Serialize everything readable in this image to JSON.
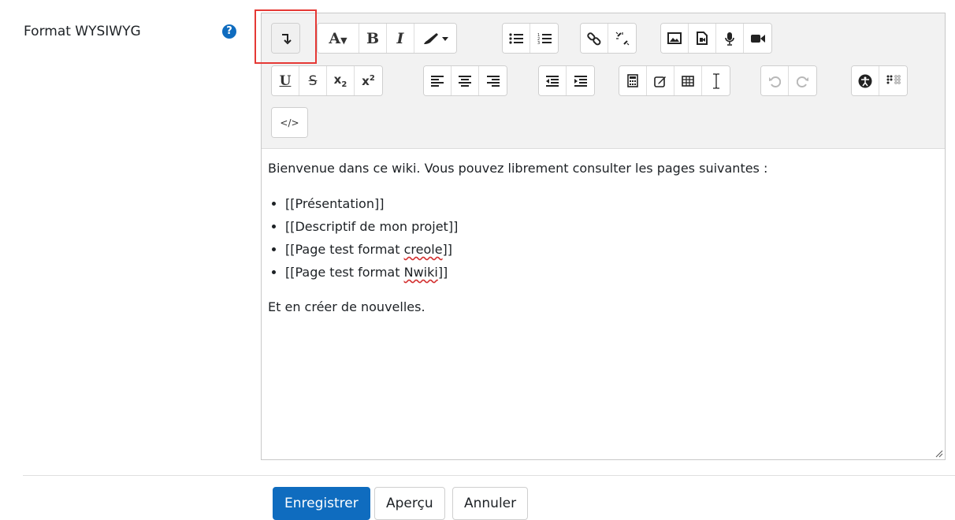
{
  "field": {
    "label": "Format WYSIWYG",
    "help_icon": "question-circle-icon",
    "help_glyph": "?"
  },
  "toolbar": {
    "rows": [
      [
        {
          "group": "collapse",
          "buttons": [
            {
              "name": "toolbar-toggle-button",
              "icon": "arrow-down-bar-icon",
              "glyph": "↧"
            }
          ]
        },
        {
          "group": "style",
          "buttons": [
            {
              "name": "paragraph-styles-button",
              "icon": "font-a-dropdown-icon",
              "glyph": "A▾"
            },
            {
              "name": "bold-button",
              "icon": "bold-icon",
              "glyph": "B"
            },
            {
              "name": "italic-button",
              "icon": "italic-icon",
              "glyph": "I"
            },
            {
              "name": "text-color-button",
              "icon": "brush-dropdown-icon",
              "glyph": "🖌▾"
            }
          ]
        },
        {
          "group": "list",
          "buttons": [
            {
              "name": "unordered-list-button",
              "icon": "bullet-list-icon",
              "glyph": "☰"
            },
            {
              "name": "ordered-list-button",
              "icon": "numbered-list-icon",
              "glyph": "⒈"
            }
          ]
        },
        {
          "group": "links",
          "buttons": [
            {
              "name": "link-button",
              "icon": "link-icon",
              "glyph": "🔗"
            },
            {
              "name": "unlink-button",
              "icon": "unlink-icon",
              "glyph": "⛓"
            }
          ]
        },
        {
          "group": "files",
          "buttons": [
            {
              "name": "image-button",
              "icon": "image-icon",
              "glyph": "▣"
            },
            {
              "name": "media-button",
              "icon": "file-media-icon",
              "glyph": "▤"
            },
            {
              "name": "record-audio-button",
              "icon": "microphone-icon",
              "glyph": "🎙"
            },
            {
              "name": "record-video-button",
              "icon": "video-camera-icon",
              "glyph": "■◀"
            }
          ]
        }
      ],
      [
        {
          "group": "style2",
          "buttons": [
            {
              "name": "underline-button",
              "icon": "underline-icon",
              "glyph": "U"
            },
            {
              "name": "strikethrough-button",
              "icon": "strikethrough-icon",
              "glyph": "S"
            },
            {
              "name": "subscript-button",
              "icon": "subscript-icon",
              "glyph": "x₂"
            },
            {
              "name": "superscript-button",
              "icon": "superscript-icon",
              "glyph": "x²"
            }
          ]
        },
        {
          "group": "align",
          "buttons": [
            {
              "name": "align-left-button",
              "icon": "align-left-icon",
              "glyph": "≡"
            },
            {
              "name": "align-center-button",
              "icon": "align-center-icon",
              "glyph": "≡"
            },
            {
              "name": "align-right-button",
              "icon": "align-right-icon",
              "glyph": "≡"
            }
          ]
        },
        {
          "group": "indent",
          "buttons": [
            {
              "name": "outdent-button",
              "icon": "outdent-icon",
              "glyph": "⇤"
            },
            {
              "name": "indent-button",
              "icon": "indent-icon",
              "glyph": "⇥"
            }
          ]
        },
        {
          "group": "insert",
          "buttons": [
            {
              "name": "equation-button",
              "icon": "calculator-icon",
              "glyph": "▦"
            },
            {
              "name": "special-chars-button",
              "icon": "edit-pencil-icon",
              "glyph": "✎"
            },
            {
              "name": "table-button",
              "icon": "table-icon",
              "glyph": "⊞"
            },
            {
              "name": "clear-formatting-button",
              "icon": "text-cursor-icon",
              "glyph": "Ɪ"
            }
          ]
        },
        {
          "group": "undo",
          "buttons": [
            {
              "name": "undo-button",
              "icon": "undo-icon",
              "glyph": "↶",
              "disabled": true
            },
            {
              "name": "redo-button",
              "icon": "redo-icon",
              "glyph": "↷",
              "disabled": true
            }
          ]
        },
        {
          "group": "accessibility",
          "buttons": [
            {
              "name": "accessibility-checker-button",
              "icon": "accessibility-icon",
              "glyph": "♿"
            },
            {
              "name": "screenreader-helper-button",
              "icon": "braille-icon",
              "glyph": "⠿"
            }
          ]
        }
      ],
      [
        {
          "group": "other",
          "buttons": [
            {
              "name": "html-source-button",
              "icon": "code-icon",
              "glyph": "</>"
            }
          ]
        }
      ]
    ]
  },
  "content": {
    "intro": "Bienvenue dans ce wiki. Vous pouvez librement consulter les pages suivantes :",
    "items": [
      {
        "before": "[[Présentation]]",
        "spell": "",
        "after": ""
      },
      {
        "before": "[[Descriptif de mon projet]]",
        "spell": "",
        "after": ""
      },
      {
        "before": "[[Page test format ",
        "spell": "creole",
        "after": "]]"
      },
      {
        "before": "[[Page test format ",
        "spell": "Nwiki",
        "after": "]]"
      }
    ],
    "outro": "Et en créer de nouvelles."
  },
  "buttons": {
    "save": "Enregistrer",
    "preview": "Aperçu",
    "cancel": "Annuler"
  },
  "colors": {
    "primary": "#0f6cbf",
    "highlight_box": "#e53935",
    "toolbar_bg": "#f2f2f2"
  }
}
